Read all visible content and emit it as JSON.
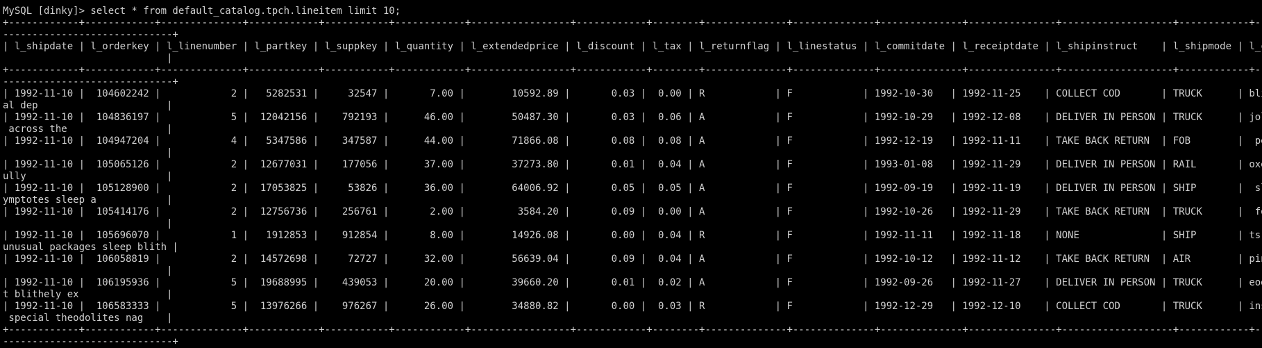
{
  "terminal": {
    "prompt": "MySQL [dinky]> ",
    "command": "select * from default_catalog.tpch.lineitem limit 10;",
    "colors": {
      "background": "#000000",
      "text": "#d0d0d0"
    }
  },
  "screen": {
    "lines": [
      "MySQL [dinky]> select * from default_catalog.tpch.lineitem limit 10;",
      "+------------+------------+--------------+------------+-----------+------------+-----------------+------------+--------+--------------+--------------+--------------+---------------+-------------------+------------+-----------------------------------------------------",
      "-----------------------------+",
      "| l_shipdate | l_orderkey | l_linenumber | l_partkey | l_suppkey | l_quantity | l_extendedprice | l_discount | l_tax | l_returnflag | l_linestatus | l_commitdate | l_receiptdate | l_shipinstruct    | l_shipmode | l_comment",
      "                            |",
      "+------------+------------+--------------+------------+-----------+------------+-----------------+------------+--------+--------------+--------------+--------------+---------------+-------------------+------------+-----------------------------------------------------",
      "-----------------------------+",
      "| 1992-11-10 |  104602242 |            2 |   5282531 |     32547 |       7.00 |        10592.89 |       0.03 |  0.00 | R            | F            | 1992-10-30   | 1992-11-25    | COLLECT COD       | TRUCK      | blithely speci",
      "al dep                      |",
      "| 1992-11-10 |  104836197 |            5 |  12042156 |    792193 |      46.00 |        50487.30 |       0.03 |  0.06 | A            | F            | 1992-10-29   | 1992-12-08    | DELIVER IN PERSON | TRUCK      | jole furiously",
      " across the                 |",
      "| 1992-11-10 |  104947204 |            4 |   5347586 |    347587 |      44.00 |        71866.08 |       0.08 |  0.08 | A            | F            | 1992-12-19   | 1992-11-11    | TAKE BACK RETURN  | FOB        |  pending depos",
      "                            |",
      "| 1992-11-10 |  105065126 |            2 |  12677031 |    177056 |      37.00 |        37273.80 |       0.01 |  0.04 | A            | F            | 1993-01-08   | 1992-11-29    | DELIVER IN PERSON | RAIL       | oxes are caref",
      "ully                        |",
      "| 1992-11-10 |  105128900 |            2 |  17053825 |     53826 |      36.00 |        64006.92 |       0.05 |  0.05 | A            | F            | 1992-09-19   | 1992-11-19    | DELIVER IN PERSON | SHIP       |  slyly bold as",
      "ymptotes sleep a            |",
      "| 1992-11-10 |  105414176 |            2 |  12756736 |    256761 |       2.00 |         3584.20 |       0.09 |  0.00 | A            | F            | 1992-10-26   | 1992-11-29    | TAKE BACK RETURN  | TRUCK      |  foxes use",
      "                            |",
      "| 1992-11-10 |  105696070 |            1 |   1912853 |    912854 |       8.00 |        14926.08 |       0.00 |  0.04 | R            | F            | 1992-11-11   | 1992-11-18    | NONE              | SHIP       | ts. carefully",
      "unusual packages sleep blith |",
      "| 1992-11-10 |  106058819 |            2 |  14572698 |     72727 |      32.00 |        56639.04 |       0.09 |  0.04 | A            | F            | 1992-10-12   | 1992-11-12    | TAKE BACK RETURN  | AIR        | pinto beans. b",
      "                            |",
      "| 1992-11-10 |  106195936 |            5 |  19688995 |    439053 |      20.00 |        39660.20 |       0.01 |  0.02 | A            | F            | 1992-09-26   | 1992-11-27    | DELIVER IN PERSON | TRUCK      | eodolites boos",
      "t blithely ex               |",
      "| 1992-11-10 |  106583333 |            5 |  13976266 |    976267 |      26.00 |        34880.82 |       0.00 |  0.03 | R            | F            | 1992-12-29   | 1992-12-10    | COLLECT COD       | TRUCK      | ins. carefully",
      " special theodolites nag    |",
      "+------------+------------+--------------+------------+-----------+------------+-----------------+------------+--------+--------------+--------------+--------------+---------------+-------------------+------------+-----------------------------------------------------",
      "-----------------------------+"
    ]
  }
}
